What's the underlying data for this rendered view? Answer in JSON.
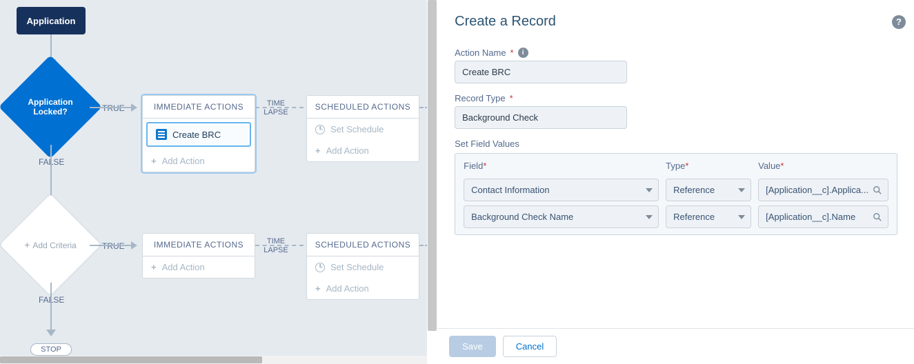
{
  "start_node": {
    "label": "Application"
  },
  "criteria": [
    {
      "label_line1": "Application",
      "label_line2": "Locked?",
      "true_label": "TRUE",
      "false_label": "FALSE"
    },
    {
      "label": "Add Criteria",
      "true_label": "TRUE",
      "false_label": "FALSE"
    }
  ],
  "immediate_header": "IMMEDIATE ACTIONS",
  "scheduled_header": "SCHEDULED ACTIONS",
  "timelapse_label": "TIME LAPSE",
  "actions": {
    "row1": {
      "immediate_action": "Create BRC",
      "add_action": "Add Action",
      "set_schedule": "Set Schedule",
      "sched_add_action": "Add Action"
    },
    "row2": {
      "add_action": "Add Action",
      "set_schedule": "Set Schedule",
      "sched_add_action": "Add Action"
    }
  },
  "stop_label": "STOP",
  "panel": {
    "title": "Create a Record",
    "action_name_label": "Action Name",
    "action_name_value": "Create BRC",
    "record_type_label": "Record Type",
    "record_type_value": "Background Check",
    "set_field_values_label": "Set Field Values",
    "columns": {
      "field": "Field",
      "type": "Type",
      "value": "Value"
    },
    "rows": [
      {
        "field": "Contact Information",
        "type": "Reference",
        "value": "[Application__c].Applica..."
      },
      {
        "field": "Background Check Name",
        "type": "Reference",
        "value": "[Application__c].Name"
      }
    ],
    "save": "Save",
    "cancel": "Cancel"
  }
}
